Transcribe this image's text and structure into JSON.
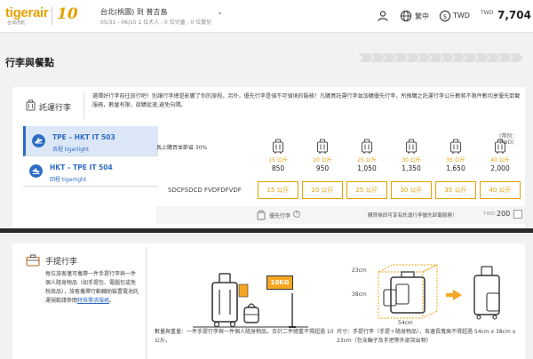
{
  "header": {
    "logo": "tigerair",
    "logo_sub": "台灣虎航",
    "anniversary": "10",
    "trip_title": "台北(桃園) 到 普吉島",
    "trip_sub": "05/31 - 06/10  1 位大人 , 0 位兒童 , 0 位嬰兒",
    "lang": "繁中",
    "currency": "TWD",
    "total_currency": "TWD",
    "total_amount": "7,704"
  },
  "page": {
    "title": "行李與餐點"
  },
  "checked": {
    "label": "託運行李",
    "description": "選擇好行李前往旅行吧！別讓行李總是影響了你的旅程。另外，優先行李是領不可領境的服務！凡購買託運行李並加購優先行李，所預購之託運行李公斤數將不限件數均享優先卸載服務，數量有限，欲購從速,避免向隅。",
    "unit_note": "(幣別：TWD)",
    "discount_note": "馬上購買並節省 30%",
    "flights": [
      {
        "name": "TPE – HKT IT 503",
        "sub": "去程 tigerlight"
      },
      {
        "name": "HKT – TPE IT 504",
        "sub": "回程 tigerlight"
      }
    ],
    "options": [
      {
        "weight": "15 公斤",
        "price": "850"
      },
      {
        "weight": "20 公斤",
        "price": "950"
      },
      {
        "weight": "25 公斤",
        "price": "1,050"
      },
      {
        "weight": "30 公斤",
        "price": "1,350"
      },
      {
        "weight": "35 公斤",
        "price": "1,650"
      },
      {
        "weight": "40 公斤",
        "price": "2,000"
      }
    ],
    "passenger": "SDCFSDCD FVDFDFVDF",
    "weight_buttons": [
      "15 公斤",
      "20 公斤",
      "25 公斤",
      "30 公斤",
      "35 公斤",
      "40 公斤"
    ],
    "priority": {
      "label": "優先行李",
      "help": "?",
      "note": "購買後即可享有託運行李優先卸載服務！",
      "currency": "TWD",
      "amount": "200",
      "checked": false
    }
  },
  "carryon": {
    "label": "手提行李",
    "description": "每位旅客僅可攜帶一件手提行李與一件個人隨身物品（如手提包、電腦包或免稅商品），旅客攜帶行動輔助裝置電池託運規範請參閱",
    "link": "特殊需求服務",
    "description_end": "。",
    "tag_weight": "10KG",
    "caption1": "數量與重量：一件手提行李與一件個人隨身物品，合計二件總重不得超過 10 公斤。",
    "dim_23": "23cm",
    "dim_38": "38cm",
    "dim_54": "54cm",
    "caption2": "尺寸：手提行李（手提＋隨身物品），各邊長寬高不得超過 54cm x 38cm x 23cm（包含輪子及手把等外部突出物）"
  },
  "colors": {
    "brand": "#e8a000",
    "accent_blue": "#2d6bc4"
  }
}
